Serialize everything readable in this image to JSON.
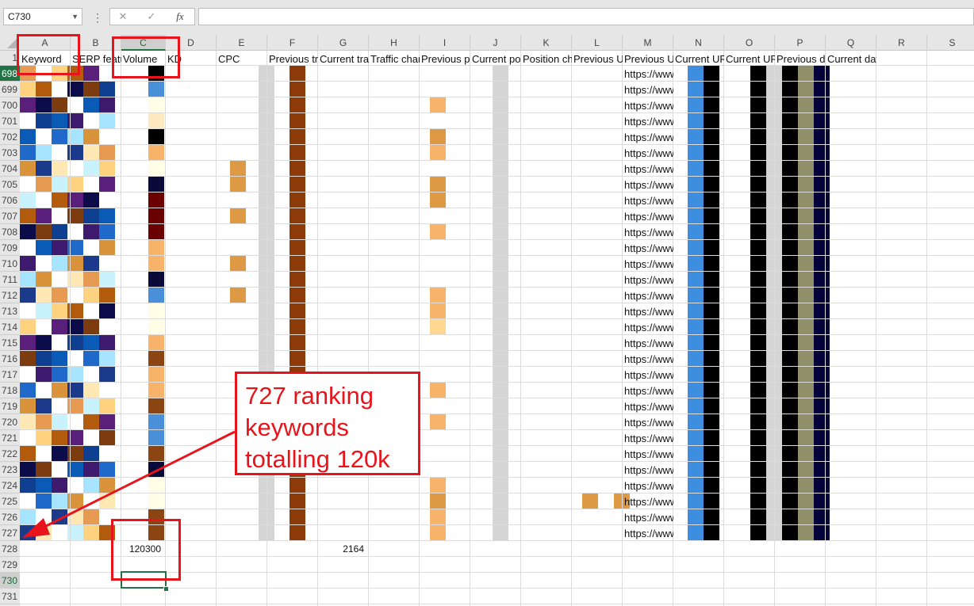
{
  "formula_bar": {
    "name_box": "C730",
    "separator": "⋮",
    "cancel_icon": "✕",
    "enter_icon": "✓",
    "function_icon": "fx",
    "formula_value": ""
  },
  "columns": [
    {
      "letter": "A",
      "header": "Keyword"
    },
    {
      "letter": "B",
      "header": "SERP features"
    },
    {
      "letter": "C",
      "header": "Volume"
    },
    {
      "letter": "D",
      "header": "KD"
    },
    {
      "letter": "E",
      "header": "CPC"
    },
    {
      "letter": "F",
      "header": "Previous traffic"
    },
    {
      "letter": "G",
      "header": "Current traffic"
    },
    {
      "letter": "H",
      "header": "Traffic change"
    },
    {
      "letter": "I",
      "header": "Previous position"
    },
    {
      "letter": "J",
      "header": "Current position"
    },
    {
      "letter": "K",
      "header": "Position change"
    },
    {
      "letter": "L",
      "header": "Previous URL"
    },
    {
      "letter": "M",
      "header": "Previous URL"
    },
    {
      "letter": "N",
      "header": "Current URL"
    },
    {
      "letter": "O",
      "header": "Current URL"
    },
    {
      "letter": "P",
      "header": "Previous date"
    },
    {
      "letter": "Q",
      "header": "Current date"
    },
    {
      "letter": "R",
      "header": ""
    },
    {
      "letter": "S",
      "header": ""
    }
  ],
  "rows": [
    "1",
    "698",
    "699",
    "700",
    "701",
    "702",
    "703",
    "704",
    "705",
    "706",
    "707",
    "708",
    "709",
    "710",
    "711",
    "712",
    "713",
    "714",
    "715",
    "716",
    "717",
    "718",
    "719",
    "720",
    "721",
    "722",
    "723",
    "724",
    "725",
    "726",
    "727",
    "728",
    "729",
    "730",
    "731"
  ],
  "url_text": "https://www",
  "totals": {
    "volume": "120300",
    "current_traffic": "2164"
  },
  "annotation": {
    "lines": [
      "727 ranking",
      "keywords",
      "totalling 120k"
    ]
  },
  "colors": {
    "annotation_red": "#e8141b",
    "excel_green": "#217346"
  }
}
